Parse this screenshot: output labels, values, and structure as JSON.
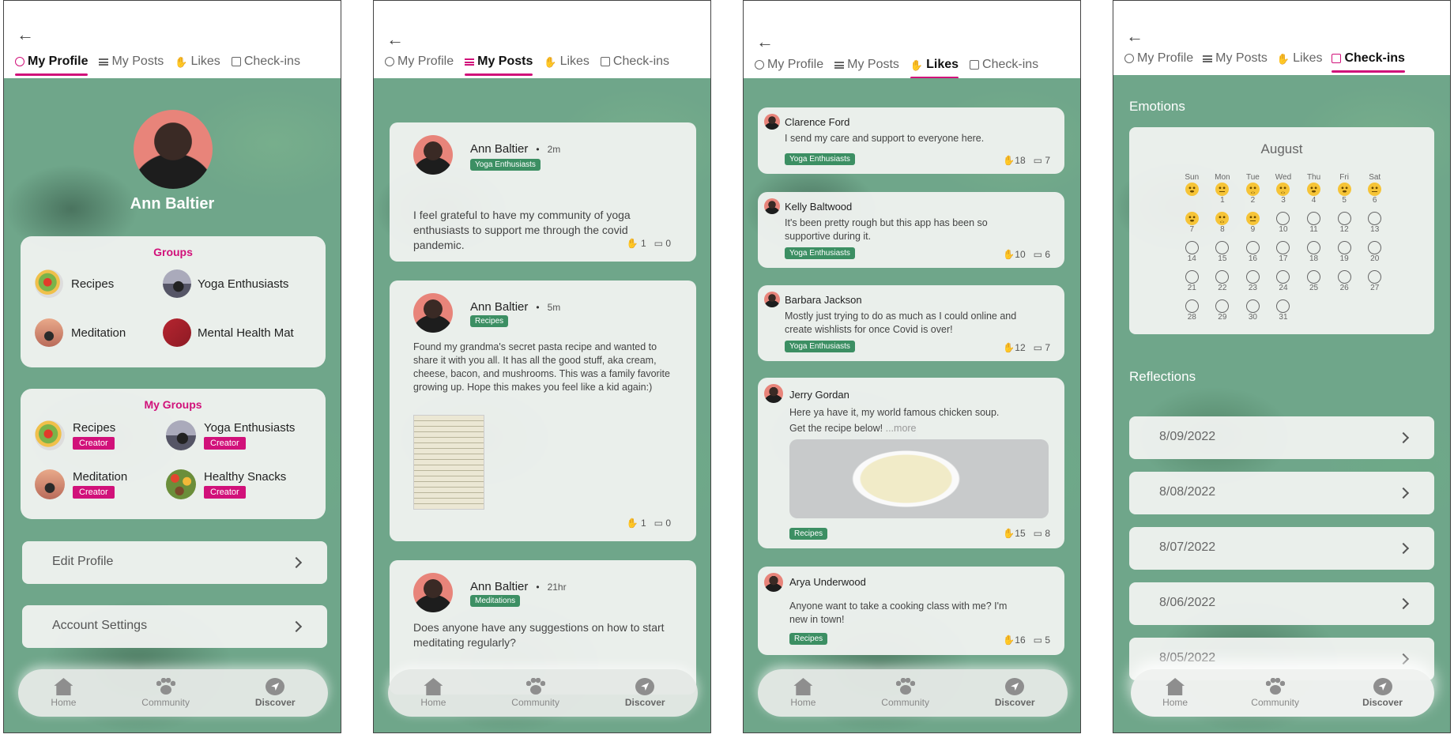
{
  "tabs": {
    "profile": "My Profile",
    "posts": "My Posts",
    "likes": "Likes",
    "checkins": "Check-ins"
  },
  "nav": {
    "home": "Home",
    "community": "Community",
    "discover": "Discover"
  },
  "profile": {
    "name": "Ann Baltier",
    "groups_title": "Groups",
    "groups": [
      "Recipes",
      "Yoga Enthusiasts",
      "Meditation",
      "Mental Health Mat"
    ],
    "my_groups_title": "My Groups",
    "my_groups": [
      "Recipes",
      "Yoga Enthusiasts",
      "Meditation",
      "Healthy Snacks"
    ],
    "creator_label": "Creator",
    "edit_profile": "Edit Profile",
    "account_settings": "Account Settings"
  },
  "posts": [
    {
      "author": "Ann Baltier",
      "time": "2m",
      "tag": "Yoga Enthusiasts",
      "text": "I feel grateful to have my community of yoga enthusiasts to support me through the covid pandemic.",
      "likes": "1",
      "comments": "0"
    },
    {
      "author": "Ann Baltier",
      "time": "5m",
      "tag": "Recipes",
      "text": "Found my grandma's secret pasta recipe and wanted to share it with you all. It has all the good stuff, aka cream, cheese, bacon, and mushrooms. This was a family favorite growing up. Hope this makes you feel like a kid again:)",
      "likes": "1",
      "comments": "0"
    },
    {
      "author": "Ann Baltier",
      "time": "21hr",
      "tag": "Meditations",
      "text": "Does anyone have any suggestions on how to start meditating regularly?"
    }
  ],
  "bullet": "•",
  "likes": [
    {
      "author": "Clarence Ford",
      "text": "I send my care and support to everyone here.",
      "tag": "Yoga Enthusiasts",
      "likes": "18",
      "comments": "7"
    },
    {
      "author": "Kelly Baltwood",
      "text": "It's been pretty rough but this app has been so supportive during it.",
      "tag": "Yoga Enthusiasts",
      "likes": "10",
      "comments": "6"
    },
    {
      "author": "Barbara Jackson",
      "text": "Mostly just trying to do as much as I could online and create wishlists for once Covid is over!",
      "tag": "Yoga Enthusiasts",
      "likes": "12",
      "comments": "7"
    },
    {
      "author": "Jerry Gordan",
      "text": "Here ya have it, my world famous chicken soup.",
      "text2": "Get the recipe below!",
      "more": "...more",
      "tag": "Recipes",
      "likes": "15",
      "comments": "8"
    },
    {
      "author": "Arya Underwood",
      "text": "Anyone want to take a cooking class with me? I'm new in town!",
      "tag": "Recipes",
      "likes": "16",
      "comments": "5"
    }
  ],
  "checkins": {
    "emotions_title": "Emotions",
    "month": "August",
    "weekdays": [
      "Sun",
      "Mon",
      "Tue",
      "Wed",
      "Thu",
      "Fri",
      "Sat"
    ],
    "reflections_title": "Reflections",
    "reflections": [
      "8/09/2022",
      "8/08/2022",
      "8/07/2022",
      "8/06/2022",
      "8/05/2022"
    ],
    "days": [
      {
        "label": "",
        "mood": "happy"
      },
      {
        "label": "1",
        "mood": "meh"
      },
      {
        "label": "2",
        "mood": "sad"
      },
      {
        "label": "3",
        "mood": "sad"
      },
      {
        "label": "4",
        "mood": "happy"
      },
      {
        "label": "5",
        "mood": "happy"
      },
      {
        "label": "6",
        "mood": "meh"
      },
      {
        "label": "7",
        "mood": "happy"
      },
      {
        "label": "8",
        "mood": "sad"
      },
      {
        "label": "9",
        "mood": "meh"
      },
      {
        "label": "10",
        "mood": "empty"
      },
      {
        "label": "11",
        "mood": "empty"
      },
      {
        "label": "12",
        "mood": "empty"
      },
      {
        "label": "13",
        "mood": "empty"
      },
      {
        "label": "14",
        "mood": "empty"
      },
      {
        "label": "15",
        "mood": "empty"
      },
      {
        "label": "16",
        "mood": "empty"
      },
      {
        "label": "17",
        "mood": "empty"
      },
      {
        "label": "18",
        "mood": "empty"
      },
      {
        "label": "19",
        "mood": "empty"
      },
      {
        "label": "20",
        "mood": "empty"
      },
      {
        "label": "21",
        "mood": "empty"
      },
      {
        "label": "22",
        "mood": "empty"
      },
      {
        "label": "23",
        "mood": "empty"
      },
      {
        "label": "24",
        "mood": "empty"
      },
      {
        "label": "25",
        "mood": "empty"
      },
      {
        "label": "26",
        "mood": "empty"
      },
      {
        "label": "27",
        "mood": "empty"
      },
      {
        "label": "28",
        "mood": "empty"
      },
      {
        "label": "29",
        "mood": "empty"
      },
      {
        "label": "30",
        "mood": "empty"
      },
      {
        "label": "31",
        "mood": "empty"
      }
    ]
  },
  "colors": {
    "accent": "#d1117a",
    "tag_green": "#3c8f63",
    "background_green": "#6fa68a"
  }
}
